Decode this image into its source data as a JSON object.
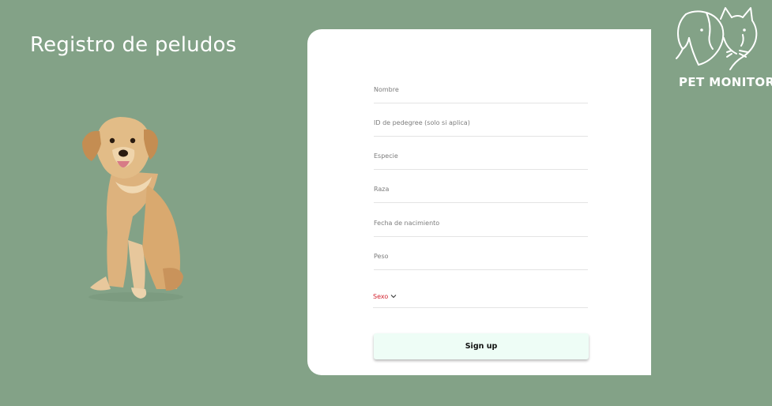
{
  "page": {
    "title": "Registro de peludos"
  },
  "brand": {
    "name": "PET MONITOR",
    "logo_icon": "dog-and-cat-icon"
  },
  "form": {
    "fields": [
      {
        "placeholder": "Nombre"
      },
      {
        "placeholder": "ID de pedegree (solo si aplica)"
      },
      {
        "placeholder": "Especie"
      },
      {
        "placeholder": "Raza"
      },
      {
        "placeholder": "Fecha de nacimiento"
      },
      {
        "placeholder": "Peso"
      }
    ],
    "sex_select": {
      "label": "Sexo",
      "icon": "chevron-down-icon"
    },
    "submit_label": "Sign up"
  },
  "hero_image": {
    "subject": "golden-retriever-dog"
  },
  "colors": {
    "background": "#83a287",
    "card": "#ffffff",
    "button": "#eefdf6",
    "select_label": "#d3232f"
  }
}
